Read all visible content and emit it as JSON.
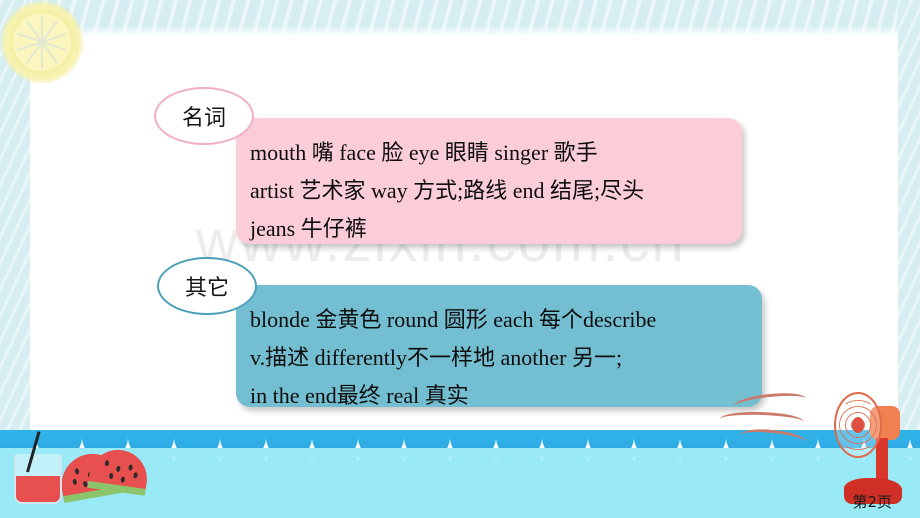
{
  "slide": {
    "page_label": "第2页",
    "watermark": "www.zixin.com.cn"
  },
  "sections": [
    {
      "id": "nouns",
      "label": "名词",
      "label_border_color": "#f2afc3",
      "box_color": "#fbcdd8",
      "lines": [
        "mouth  嘴    face 脸    eye 眼睛    singer 歌手",
        "artist 艺术家    way 方式;路线    end 结尾;尽头",
        "jeans 牛仔裤"
      ]
    },
    {
      "id": "others",
      "label": "其它",
      "label_border_color": "#4c9fb8",
      "box_color": "#74bed2",
      "lines": [
        "blonde  金黄色   round 圆形     each  每个describe",
        "v.描述   differently不一样地   another 另一;",
        "in the end最终     real 真实"
      ]
    }
  ],
  "decorations": {
    "lemon": "lemon-slice-icon",
    "watermelon": "watermelon-icon",
    "juice": "juice-glass-icon",
    "fan": "electric-fan-icon",
    "waves": "wave-border-icon"
  }
}
